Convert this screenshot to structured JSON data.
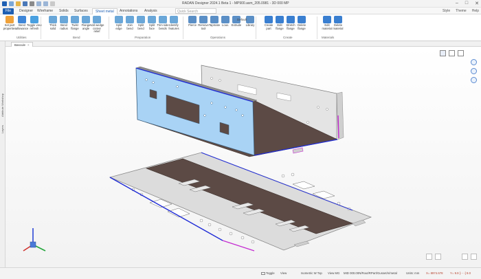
{
  "window": {
    "title": "RADAN Designer 2024.1 Beta 1 - MP900.asm_205.0981 - 3D 000 MP",
    "controls": [
      "–",
      "□",
      "✕"
    ]
  },
  "tabs": [
    {
      "label": "File"
    },
    {
      "label": "Designer"
    },
    {
      "label": "Wireframe"
    },
    {
      "label": "Solids"
    },
    {
      "label": "Surfaces"
    },
    {
      "label": "Sheet metal"
    },
    {
      "label": "Annotations"
    },
    {
      "label": "Analysis"
    }
  ],
  "quick_search": {
    "placeholder": "Quick Search"
  },
  "tab_right": {
    "style": "Style",
    "theme": "Theme",
    "help": "Help"
  },
  "ribbon": {
    "buttons": [
      {
        "label": "Set part\nproperties",
        "color": "#f0a23b"
      },
      {
        "label": "Bend\nallowance",
        "color": "#3f86d8"
      },
      {
        "label": "Toggle view\nrefresh",
        "color": "#4aa0e0"
      },
      {
        "label": "Thick\nsolid",
        "color": "#6aa7d8"
      },
      {
        "label": "Bend\nradius",
        "color": "#6aa7d8"
      },
      {
        "label": "Twist\nflange",
        "color": "#6aa7d8"
      },
      {
        "label": "Flange\nangle",
        "color": "#6aa7d8"
      },
      {
        "label": "Add wedge\ncorner relief",
        "color": "#6aa7d8"
      },
      {
        "label": "Split\nedge",
        "color": "#6aa7d8"
      },
      {
        "label": "Join\nbend",
        "color": "#6aa7d8"
      },
      {
        "label": "Split\nbend",
        "color": "#6aa7d8"
      },
      {
        "label": "Split\nface",
        "color": "#6aa7d8"
      },
      {
        "label": "Trim side\nbends",
        "color": "#6aa7d8"
      },
      {
        "label": "Identify\nfeatures",
        "color": "#6aa7d8"
      },
      {
        "label": "Pierce",
        "color": "#5b8fc6"
      },
      {
        "label": "Remove\ntool",
        "color": "#5b8fc6"
      },
      {
        "label": "Tapmate",
        "color": "#5b8fc6"
      },
      {
        "label": "Louv.",
        "color": "#5b8fc6"
      },
      {
        "label": "Extrude",
        "color": "#5b8fc6"
      },
      {
        "label": "Library",
        "color": "#5b8fc6"
      },
      {
        "label": "Create\npart",
        "color": "#3a7fd0"
      },
      {
        "label": "Edit\nflange",
        "color": "#3a7fd0"
      },
      {
        "label": "Stretch\nflange",
        "color": "#3a7fd0"
      },
      {
        "label": "Delete\nflange",
        "color": "#3a7fd0"
      },
      {
        "label": "Edit\nmaterial",
        "color": "#3a7fd0"
      },
      {
        "label": "Delete\nmaterial",
        "color": "#3a7fd0"
      }
    ],
    "groups": [
      "Utilities",
      "Bend",
      "Preparation",
      "Operations",
      "Create",
      "Materials"
    ],
    "extra": {
      "default_label": "Default"
    }
  },
  "left_panel": {
    "tabs": [
      "Attribute Workshop",
      "Layers"
    ]
  },
  "document_tab": {
    "label": "Bascule",
    "close": "×"
  },
  "viewport": {
    "background": "#f5f5f5"
  },
  "status_bar": {
    "toggle_label": "Toggle",
    "view_label": "View",
    "mode_text": "Isometric W Top",
    "units_text": "View MG",
    "path_text": "MID 000.00N/Rout/RPart/Gusset/n/metal",
    "units_value": "Units: mm",
    "coords": "X= 8974.678",
    "coords_y": "Y= 9.9 [- - -] 9.0",
    "zoom_label": "Fit view"
  },
  "colors": {
    "accent": "#1e5fb3",
    "selected_face": "#a9d3f5",
    "sheet": "#dddddd",
    "perforated": "#5c4a45",
    "edge_blue": "#1f2bd6",
    "edge_magenta": "#c42bd1"
  }
}
